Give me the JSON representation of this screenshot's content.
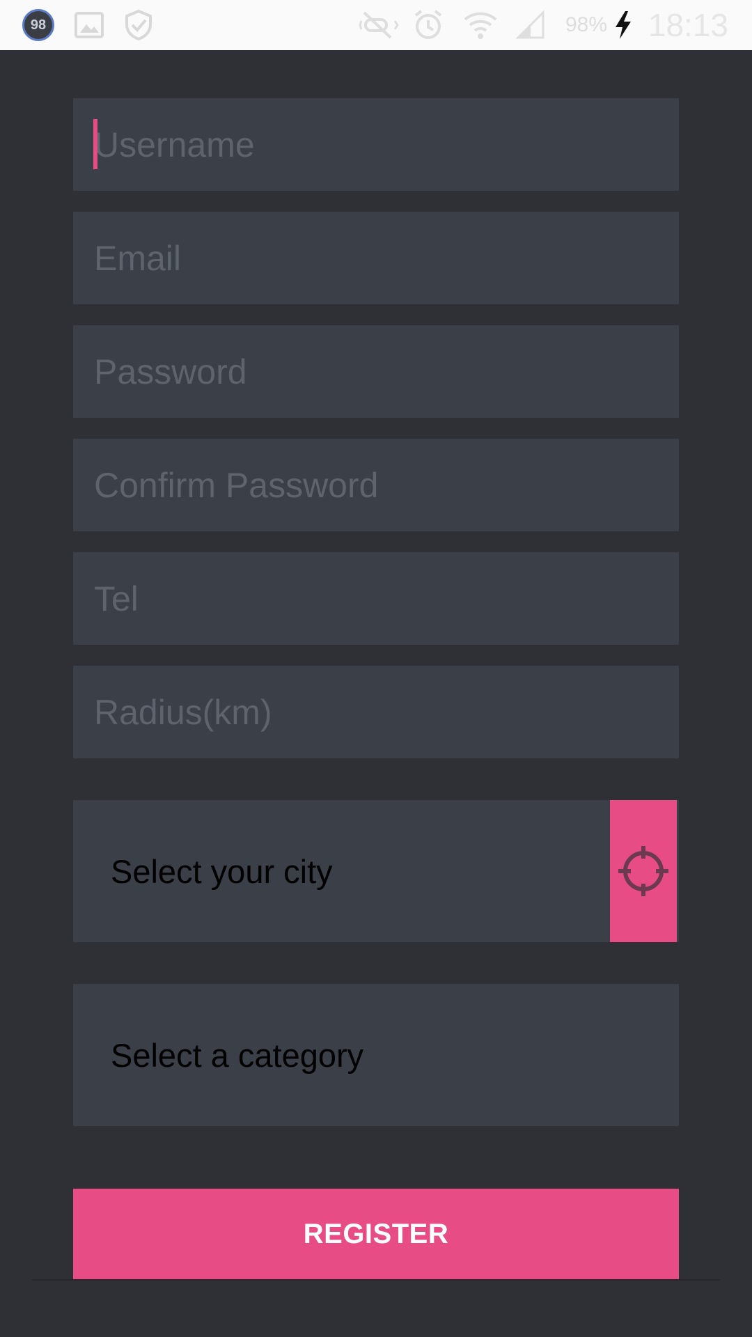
{
  "status_bar": {
    "notification_count": "98",
    "battery_percent": "98%",
    "time": "18:13",
    "icons": [
      "gallery-icon",
      "shield-check-icon",
      "mute-icon",
      "alarm-icon",
      "wifi-icon",
      "signal-icon",
      "charging-icon"
    ]
  },
  "form": {
    "username_placeholder": "Username",
    "email_placeholder": "Email",
    "password_placeholder": "Password",
    "confirm_password_placeholder": "Confirm Password",
    "tel_placeholder": "Tel",
    "radius_placeholder": "Radius(km)",
    "city_select_label": "Select your city",
    "category_select_label": "Select a category",
    "register_label": "REGISTER",
    "locate_icon": "crosshair-icon"
  },
  "colors": {
    "background": "#2e3035",
    "field": "#3a3f48",
    "accent": "#e84c84",
    "placeholder": "#5e636c"
  }
}
